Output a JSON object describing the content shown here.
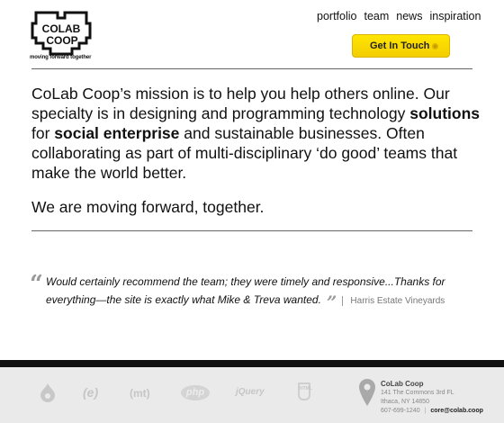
{
  "brand": {
    "logo_line1": "COLAB",
    "logo_line2": "COOP",
    "tagline": "moving forward together"
  },
  "nav": {
    "items": [
      "portfolio",
      "team",
      "news",
      "inspiration"
    ]
  },
  "cta": {
    "label": "Get In Touch"
  },
  "mission": {
    "p1_a": "CoLab Coop’s mission is to help you help others online. Our specialty is in designing and programming technology ",
    "p1_b": "solutions",
    "p1_c": " for ",
    "p1_d": "social enterprise",
    "p1_e": " and sustainable businesses. Often collaborating as part of multi-disciplinary ‘do good’ teams that make the world better.",
    "p2": "We are moving forward, together."
  },
  "testimonial": {
    "text": "Would certainly recommend the team; they were timely and responsive...Thanks for everything—the site is exactly what Mike & Treva wanted.",
    "author": "Harris Estate Vineyards"
  },
  "footer": {
    "tech_logos": [
      "drupal-icon",
      "ee-icon",
      "mt-icon",
      "php-icon",
      "jquery-icon",
      "html5-icon"
    ],
    "tech_labels": [
      "(e)",
      "(mt)",
      "php",
      "jQuery",
      "HTML"
    ],
    "contact": {
      "name": "CoLab Coop",
      "address1": "141 The Commons 3rd FL",
      "address2": "Ithaca, NY 14850",
      "phone": "607-699-1240",
      "email": "core@colab.coop"
    }
  }
}
